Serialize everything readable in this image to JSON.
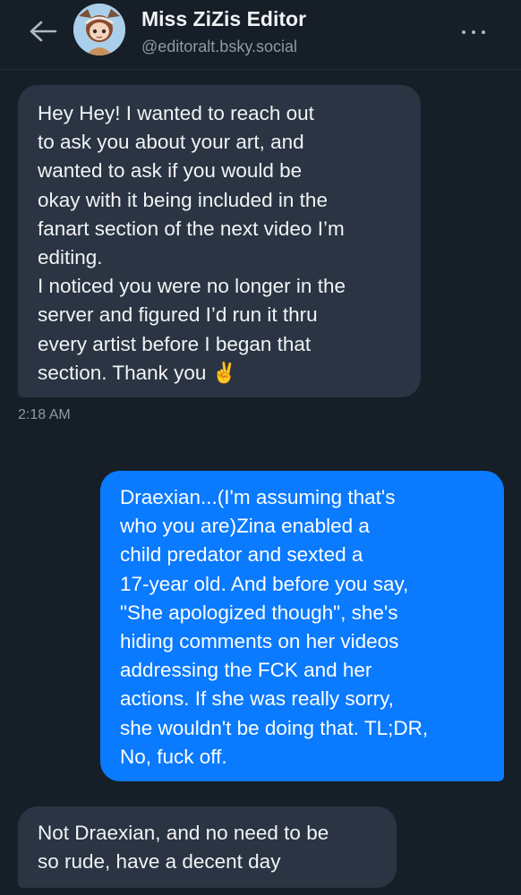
{
  "header": {
    "back_icon": "arrow-left-icon",
    "title": "Miss ZiZis Editor",
    "handle": "@editoralt.bsky.social",
    "more_icon": "more-horizontal-icon"
  },
  "messages": [
    {
      "direction": "incoming",
      "text": "Hey Hey! I wanted to reach out\nto ask you about your art, and\nwanted to ask if you would be\nokay with it being included in the\nfanart section of the next video I’m\nediting.\nI noticed you were no longer in the\nserver and figured I’d run it thru\nevery artist before I began that\nsection. Thank you ✌️",
      "time": "2:18 AM"
    },
    {
      "direction": "outgoing",
      "text": "Draexian...(I'm assuming that's\nwho you are)Zina enabled a\nchild predator and sexted a\n17-year old. And before you say,\n\"She apologized though\", she's\nhiding comments on her videos\naddressing the FCK and her\nactions. If she was really sorry,\nshe wouldn't be doing that. TL;DR,\nNo, fuck off."
    },
    {
      "direction": "incoming",
      "text": "Not Draexian, and no need to be\nso rude, have a decent day"
    }
  ],
  "colors": {
    "background": "#161e27",
    "incoming_bubble": "#2a3442",
    "outgoing_bubble": "#0a7aff",
    "text_primary": "#f1f3f5",
    "text_secondary": "#8d99a6"
  }
}
